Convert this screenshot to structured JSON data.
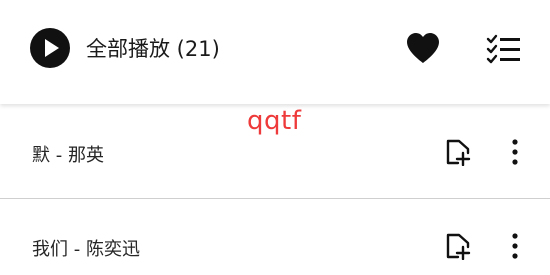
{
  "header": {
    "play_all_label": "全部播放 (21)",
    "icons": {
      "play": "play-icon",
      "favorite": "heart-icon",
      "select": "checklist-icon"
    }
  },
  "watermark": "qqtf",
  "songs": [
    {
      "title": "默 - 那英",
      "actions": [
        "add-to-playlist-icon",
        "more-vertical-icon"
      ]
    },
    {
      "title": "我们 - 陈奕迅",
      "actions": [
        "add-to-playlist-icon",
        "more-vertical-icon"
      ]
    }
  ],
  "colors": {
    "watermark": "#ee3a3a",
    "icon": "#111111",
    "divider": "#cfcfcf"
  }
}
